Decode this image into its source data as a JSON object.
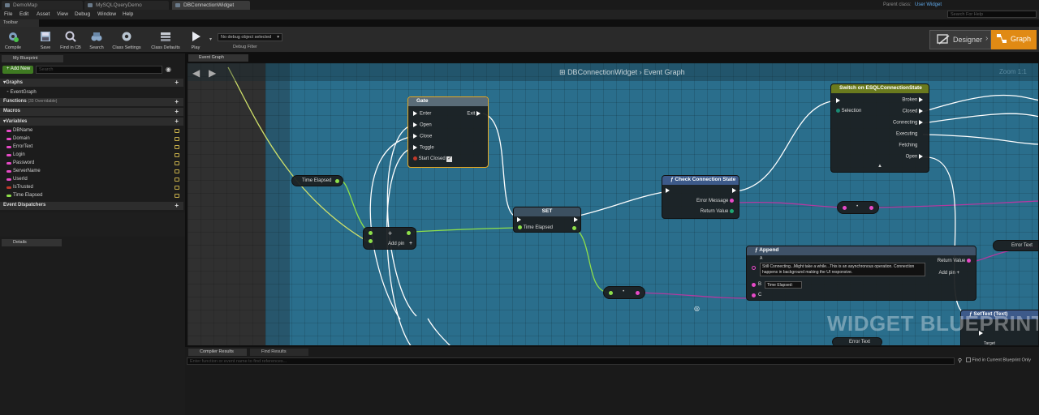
{
  "doc_tabs": [
    "DemoMap",
    "MySQLQueryDemo",
    "DBConnectionWidget"
  ],
  "menu": [
    "File",
    "Edit",
    "Asset",
    "View",
    "Debug",
    "Window",
    "Help"
  ],
  "parent_class": {
    "label": "Parent class:",
    "value": "User Widget"
  },
  "help_search": {
    "placeholder": "Search For Help"
  },
  "toolbar": {
    "tab": "Toolbar",
    "buttons": [
      "Compile",
      "Save",
      "Find in CB",
      "Search",
      "Class Settings",
      "Class Defaults",
      "Play"
    ],
    "debug_select": "No debug object selected",
    "debug_label": "Debug Filter"
  },
  "mode": {
    "designer": "Designer",
    "graph": "Graph"
  },
  "left_panel": {
    "tab": "My Blueprint",
    "add_new": "+ Add New",
    "search_placeholder": "Search",
    "graphs_header": "Graphs",
    "graphs": [
      "EventGraph"
    ],
    "functions_header": "Functions",
    "functions_note": "(33 Overridable)",
    "macros_header": "Macros",
    "variables_header": "Variables",
    "variables": [
      {
        "name": "DBName",
        "color": "#e84ac8"
      },
      {
        "name": "Domain",
        "color": "#e84ac8"
      },
      {
        "name": "ErrorText",
        "color": "#e84ac8"
      },
      {
        "name": "Login",
        "color": "#e84ac8"
      },
      {
        "name": "Password",
        "color": "#e84ac8"
      },
      {
        "name": "ServerName",
        "color": "#e84ac8"
      },
      {
        "name": "UserId",
        "color": "#e84ac8"
      },
      {
        "name": "IsTrusted",
        "color": "#c0392b"
      },
      {
        "name": "Time Elapsed",
        "color": "#8ee04a"
      }
    ],
    "dispatchers_header": "Event Dispatchers",
    "details_tab": "Details"
  },
  "graph": {
    "tab": "Event Graph",
    "breadcrumb": {
      "widget": "DBConnectionWidget",
      "sep": "›",
      "graph": "Event Graph"
    },
    "zoom": "Zoom 1:1",
    "watermark": "WIDGET BLUEPRINT",
    "nodes": {
      "gate": {
        "title": "Gate",
        "inputs": [
          "Enter",
          "Open",
          "Close",
          "Toggle",
          "Start Closed"
        ],
        "output": "Exit"
      },
      "time_elapsed_get": {
        "label": "Time Elapsed"
      },
      "add_node": {
        "label": "Add pin"
      },
      "set_node": {
        "title": "SET",
        "pin": "Time Elapsed"
      },
      "check_connection": {
        "title": "Check Connection State",
        "outputs": [
          "Error Message",
          "Return Value"
        ]
      },
      "switch": {
        "title": "Switch on ESQLConnectionState",
        "input": "Selection",
        "outputs": [
          "Broken",
          "Closed",
          "Connecting",
          "Executing",
          "Fetching",
          "Open"
        ]
      },
      "append": {
        "title": "Append",
        "a_text": "Still Connecting...Might take a while...This is an asynchronous operation. Connection happens in background making the UI responsive.",
        "b_text": "Time Elapsed:",
        "return": "Return Value",
        "add_pin": "Add pin",
        "pin_a": "A",
        "pin_b": "B",
        "pin_c": "C"
      },
      "error_text_get": {
        "label": "Error Text"
      },
      "set_text": {
        "title": "SetText (Text)",
        "target": "Target"
      },
      "error_text_bottom": {
        "label": "Error Text"
      }
    }
  },
  "bottom": {
    "tabs": [
      "Compiler Results",
      "Find Results"
    ],
    "find_placeholder": "Enter function or event name to find references...",
    "find_current": "Find in Current Blueprint Only"
  }
}
